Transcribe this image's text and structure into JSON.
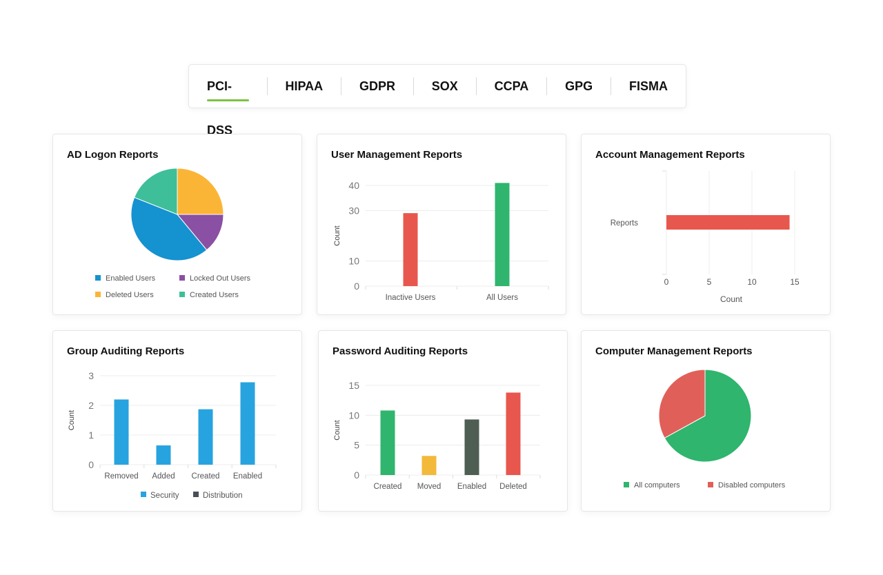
{
  "tabs": [
    {
      "label": "PCI-DSS",
      "active": true
    },
    {
      "label": "HIPAA"
    },
    {
      "label": "GDPR"
    },
    {
      "label": "SOX"
    },
    {
      "label": "CCPA"
    },
    {
      "label": "GPG"
    },
    {
      "label": "FISMA"
    }
  ],
  "accent_color": "#7cc242",
  "cards": [
    {
      "title": "AD Logon Reports"
    },
    {
      "title": "User Management Reports"
    },
    {
      "title": "Account Management Reports"
    },
    {
      "title": "Group Auditing Reports"
    },
    {
      "title": "Password Auditing Reports"
    },
    {
      "title": "Computer Management Reports"
    }
  ],
  "chart_data": [
    {
      "type": "pie",
      "title": "AD Logon Reports",
      "legend": "bottom",
      "slices": [
        {
          "label": "Deleted Users",
          "value": 25,
          "color": "#fbb536"
        },
        {
          "label": "Locked Out Users",
          "value": 14,
          "color": "#8a50a3"
        },
        {
          "label": "Enabled Users",
          "value": 42,
          "color": "#1592d0"
        },
        {
          "label": "Created Users",
          "value": 19,
          "color": "#3ebf99"
        }
      ],
      "legend_order": [
        "Enabled Users",
        "Locked Out Users",
        "Deleted Users",
        "Created Users"
      ]
    },
    {
      "type": "bar",
      "title": "User Management Reports",
      "ylabel": "Count",
      "ylim": [
        0,
        40
      ],
      "yticks": [
        0,
        10,
        30,
        40
      ],
      "categories": [
        "Inactive Users",
        "All Users"
      ],
      "values": [
        29,
        41
      ],
      "colors": [
        "#e8574d",
        "#2fb56d"
      ],
      "grid": true
    },
    {
      "type": "bar",
      "orientation": "horizontal",
      "title": "Account Management Reports",
      "xlabel": "Count",
      "xlim": [
        0,
        15
      ],
      "xticks": [
        0,
        5,
        10,
        15
      ],
      "categories": [
        "Reports"
      ],
      "values": [
        14.4
      ],
      "colors": [
        "#e8574d"
      ],
      "grid": true
    },
    {
      "type": "bar",
      "title": "Group Auditing Reports",
      "ylabel": "Count",
      "ylim": [
        0,
        3
      ],
      "yticks": [
        0,
        1,
        2,
        3
      ],
      "categories": [
        "Removed",
        "Added",
        "Created",
        "Enabled"
      ],
      "series": [
        {
          "name": "Security",
          "values": [
            2.2,
            0.65,
            1.87,
            2.78
          ],
          "color": "#27a3e0"
        },
        {
          "name": "Distribution",
          "values": [
            0,
            0,
            0,
            0
          ],
          "color": "#4a4f57"
        }
      ],
      "legend": "bottom",
      "grid": true
    },
    {
      "type": "bar",
      "title": "Password Auditing Reports",
      "ylabel": "Count",
      "ylim": [
        0,
        15
      ],
      "yticks": [
        0,
        5,
        10,
        15
      ],
      "categories": [
        "Created",
        "Moved",
        "Enabled",
        "Deleted"
      ],
      "values": [
        10.8,
        3.2,
        9.3,
        13.8
      ],
      "colors": [
        "#2fb56d",
        "#f2b93b",
        "#4e5e53",
        "#e8574d"
      ],
      "grid": true
    },
    {
      "type": "pie",
      "title": "Computer Management Reports",
      "legend": "bottom",
      "slices": [
        {
          "label": "All computers",
          "value": 67,
          "color": "#2fb56d"
        },
        {
          "label": "Disabled computers",
          "value": 33,
          "color": "#e06059"
        }
      ]
    }
  ]
}
